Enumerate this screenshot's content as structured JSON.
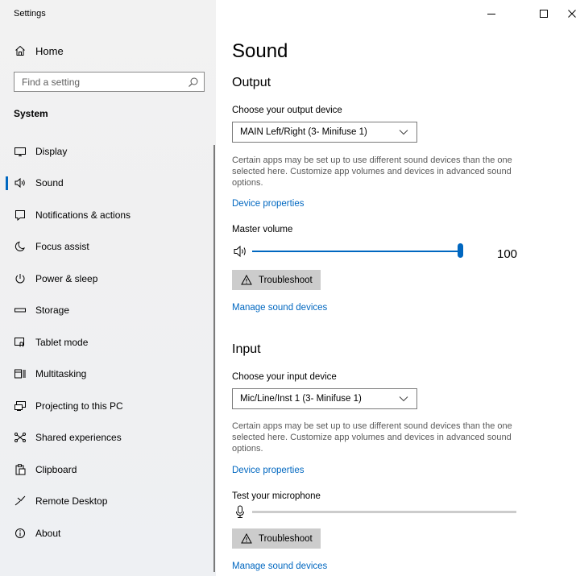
{
  "window": {
    "title": "Settings"
  },
  "sidebar": {
    "home_label": "Home",
    "search_placeholder": "Find a setting",
    "section": "System",
    "items": [
      {
        "label": "Display",
        "icon": "display-icon"
      },
      {
        "label": "Sound",
        "icon": "speaker-icon",
        "active": true
      },
      {
        "label": "Notifications & actions",
        "icon": "notification-icon"
      },
      {
        "label": "Focus assist",
        "icon": "moon-icon"
      },
      {
        "label": "Power & sleep",
        "icon": "power-icon"
      },
      {
        "label": "Storage",
        "icon": "storage-icon"
      },
      {
        "label": "Tablet mode",
        "icon": "tablet-icon"
      },
      {
        "label": "Multitasking",
        "icon": "multitasking-icon"
      },
      {
        "label": "Projecting to this PC",
        "icon": "projecting-icon"
      },
      {
        "label": "Shared experiences",
        "icon": "shared-icon"
      },
      {
        "label": "Clipboard",
        "icon": "clipboard-icon"
      },
      {
        "label": "Remote Desktop",
        "icon": "remote-desktop-icon"
      },
      {
        "label": "About",
        "icon": "info-icon"
      }
    ]
  },
  "main": {
    "page_title": "Sound",
    "output": {
      "heading": "Output",
      "device_label": "Choose your output device",
      "device_value": "MAIN Left/Right (3- Minifuse 1)",
      "description": "Certain apps may be set up to use different sound devices than the one selected here. Customize app volumes and devices in advanced sound options.",
      "device_properties": "Device properties",
      "volume_label": "Master volume",
      "volume_value": "100",
      "volume_level": 1.0,
      "troubleshoot": "Troubleshoot",
      "manage": "Manage sound devices"
    },
    "input": {
      "heading": "Input",
      "device_label": "Choose your input device",
      "device_value": "Mic/Line/Inst 1 (3- Minifuse 1)",
      "description": "Certain apps may be set up to use different sound devices than the one selected here. Customize app volumes and devices in advanced sound options.",
      "device_properties": "Device properties",
      "test_label": "Test your microphone",
      "mic_level": 0.0,
      "troubleshoot": "Troubleshoot",
      "manage": "Manage sound devices"
    }
  },
  "colors": {
    "accent": "#0067c0",
    "sidebar_bg": "#f2f2f2",
    "button_bg": "#cccccc"
  }
}
